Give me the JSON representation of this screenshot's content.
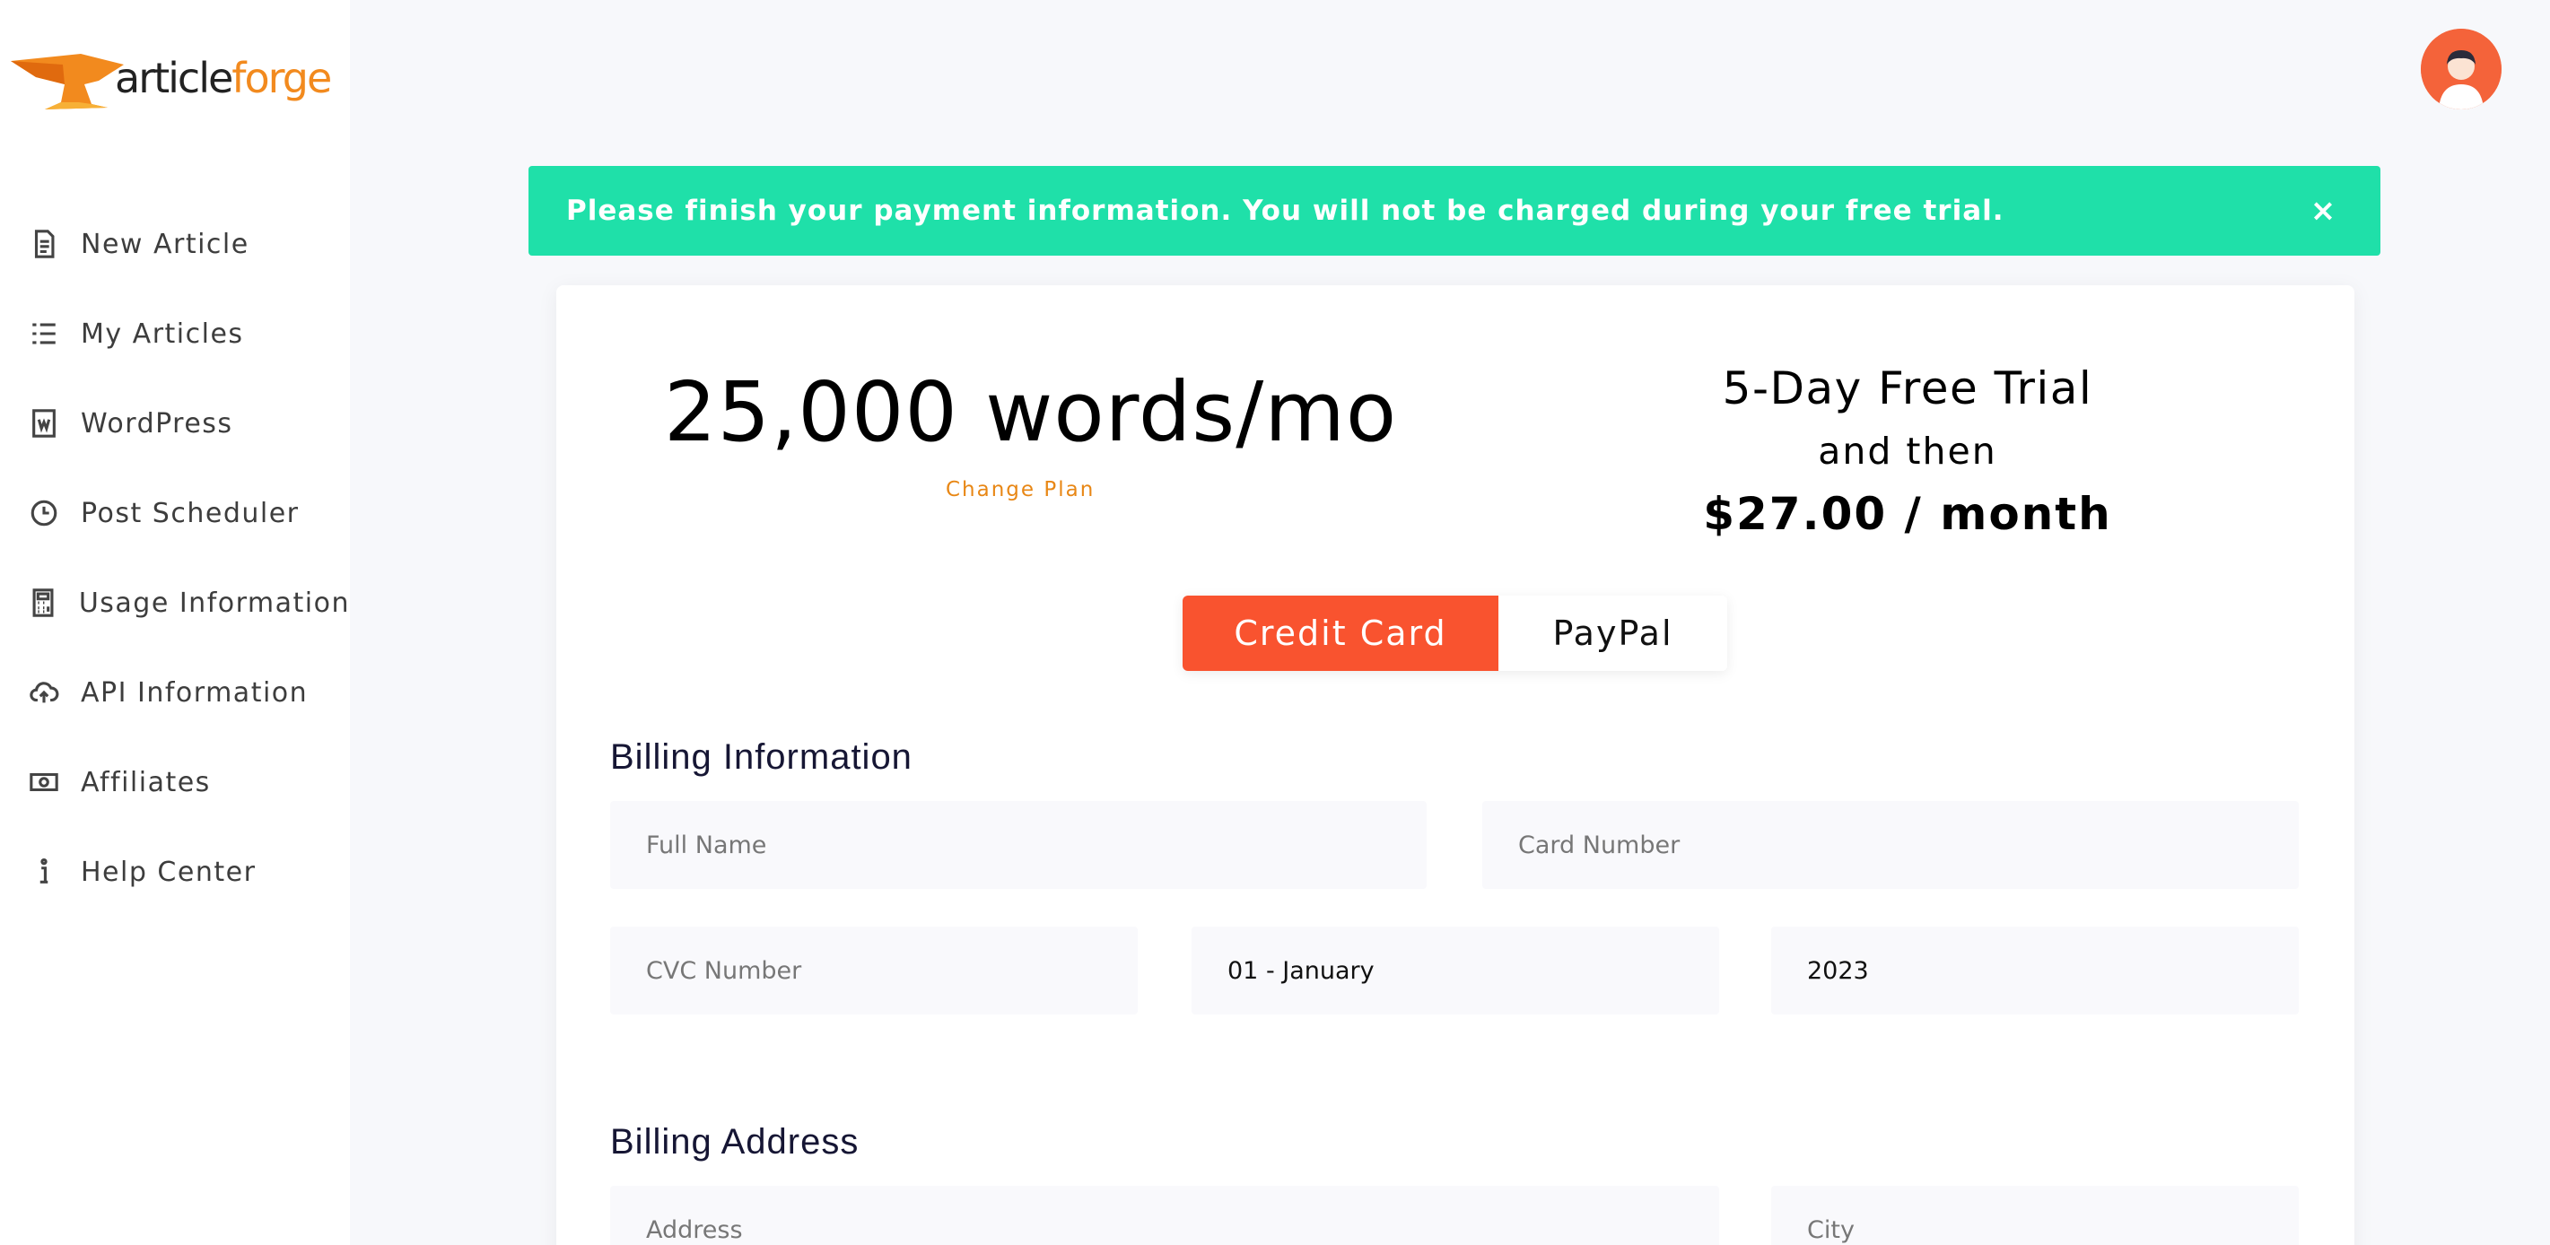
{
  "brand": {
    "logo_part1": "article",
    "logo_part2": "forge",
    "accent": "#f28a1e"
  },
  "sidebar": {
    "items": [
      {
        "label": "New Article",
        "icon": "document-icon"
      },
      {
        "label": "My Articles",
        "icon": "list-icon"
      },
      {
        "label": "WordPress",
        "icon": "wordpress-icon"
      },
      {
        "label": "Post Scheduler",
        "icon": "clock-icon"
      },
      {
        "label": "Usage Information",
        "icon": "calculator-icon"
      },
      {
        "label": "API Information",
        "icon": "cloud-upload-icon"
      },
      {
        "label": "Affiliates",
        "icon": "money-icon"
      },
      {
        "label": "Help Center",
        "icon": "info-icon"
      }
    ]
  },
  "header": {
    "avatar_icon": "user-avatar-icon"
  },
  "banner": {
    "message": "Please finish your payment information. You will not be charged during your free trial.",
    "close_symbol": "×",
    "color": "#1fe0a9"
  },
  "plan": {
    "words": "25,000 words/mo",
    "change_plan": "Change Plan",
    "trial_title": "5-Day Free Trial",
    "trial_then": "and then",
    "trial_price": "$27.00 / month"
  },
  "payment": {
    "tabs": [
      {
        "label": "Credit Card",
        "active": true
      },
      {
        "label": "PayPal",
        "active": false
      }
    ],
    "active_color": "#f9532f"
  },
  "billing": {
    "title": "Billing Information",
    "full_name_placeholder": "Full Name",
    "card_number_placeholder": "Card Number",
    "cvc_placeholder": "CVC Number",
    "month_value": "01 - January",
    "year_value": "2023"
  },
  "address": {
    "title": "Billing Address",
    "address_placeholder": "Address",
    "city_placeholder": "City"
  }
}
